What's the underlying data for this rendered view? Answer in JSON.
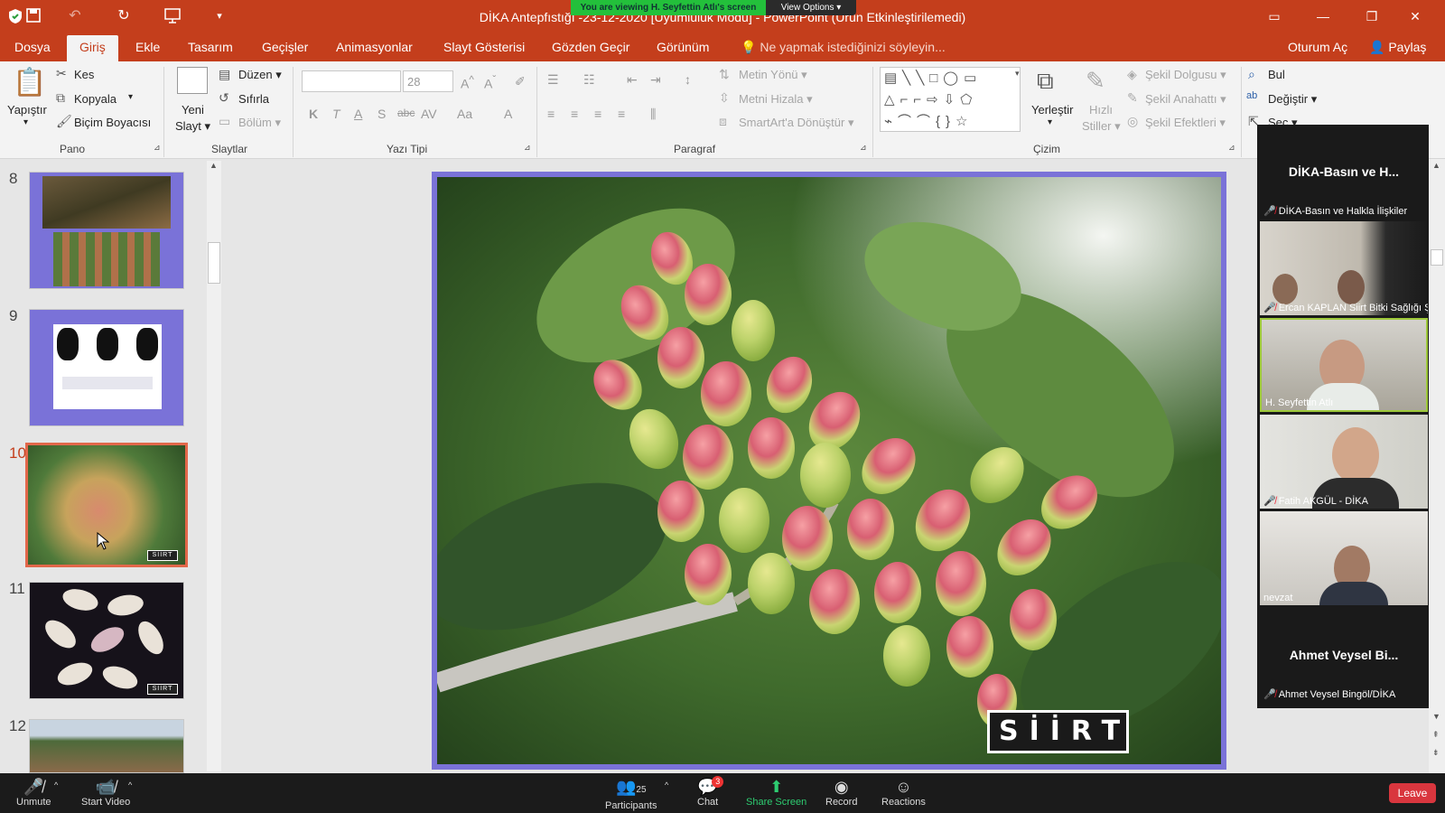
{
  "window": {
    "title": "DİKA Antepfıstığı -23-12-2020 [Uyumluluk Modu] - PowerPoint (Ürün Etkinleştirilemedi)",
    "account": "Oturum Aç",
    "share": "Paylaş"
  },
  "zoom_banner": {
    "viewing": "You are viewing H. Seyfettin Atlı's screen",
    "view_options": "View Options"
  },
  "tabs": [
    "Dosya",
    "Giriş",
    "Ekle",
    "Tasarım",
    "Geçişler",
    "Animasyonlar",
    "Slayt Gösterisi",
    "Gözden Geçir",
    "Görünüm"
  ],
  "tell_me": "Ne yapmak istediğinizi söyleyin...",
  "ribbon": {
    "pano": {
      "label": "Pano",
      "paste": "Yapıştır",
      "cut": "Kes",
      "copy": "Kopyala",
      "format_painter": "Biçim Boyacısı"
    },
    "slaytlar": {
      "label": "Slaytlar",
      "new_slide_1": "Yeni",
      "new_slide_2": "Slayt",
      "layout": "Düzen",
      "reset": "Sıfırla",
      "section": "Bölüm"
    },
    "yazi_tipi": {
      "label": "Yazı Tipi",
      "font_size": "28",
      "bold": "K",
      "italic": "T",
      "underline": "A",
      "shadow": "S",
      "strike": "abc",
      "spacing": "AV",
      "case": "Aa",
      "color": "A"
    },
    "paragraf": {
      "label": "Paragraf",
      "text_direction": "Metin Yönü",
      "align_text": "Metni Hizala",
      "smartart": "SmartArt'a Dönüştür"
    },
    "cizim": {
      "label": "Çizim",
      "arrange": "Yerleştir",
      "quick_styles_1": "Hızlı",
      "quick_styles_2": "Stiller",
      "shape_fill": "Şekil Dolgusu",
      "shape_outline": "Şekil Anahattı",
      "shape_effects": "Şekil Efektleri"
    },
    "duzenleme": {
      "find": "Bul",
      "replace": "Değiştir",
      "select": "Seç"
    }
  },
  "slides": [
    {
      "num": "8"
    },
    {
      "num": "9"
    },
    {
      "num": "10"
    },
    {
      "num": "11"
    },
    {
      "num": "12"
    }
  ],
  "slide_logo": "SİİRT",
  "thumb_logo": "SİİRT",
  "participants": [
    {
      "big": "DİKA-Basın ve H...",
      "name": "DİKA-Basın ve Halkla İlişkiler"
    },
    {
      "name": "Ercan KAPLAN Siirt Bitki Sağlığı Ş..."
    },
    {
      "name": "H. Seyfettin Atlı"
    },
    {
      "name": "Fatih AKGÜL - DİKA"
    },
    {
      "name": "nevzat"
    },
    {
      "big": "Ahmet Veysel Bi...",
      "name": "Ahmet Veysel Bingöl/DİKA"
    }
  ],
  "zoombar": {
    "unmute": "Unmute",
    "start_video": "Start Video",
    "participants": "Participants",
    "participants_count": "25",
    "chat": "Chat",
    "chat_badge": "3",
    "share_screen": "Share Screen",
    "record": "Record",
    "reactions": "Reactions",
    "leave": "Leave"
  }
}
